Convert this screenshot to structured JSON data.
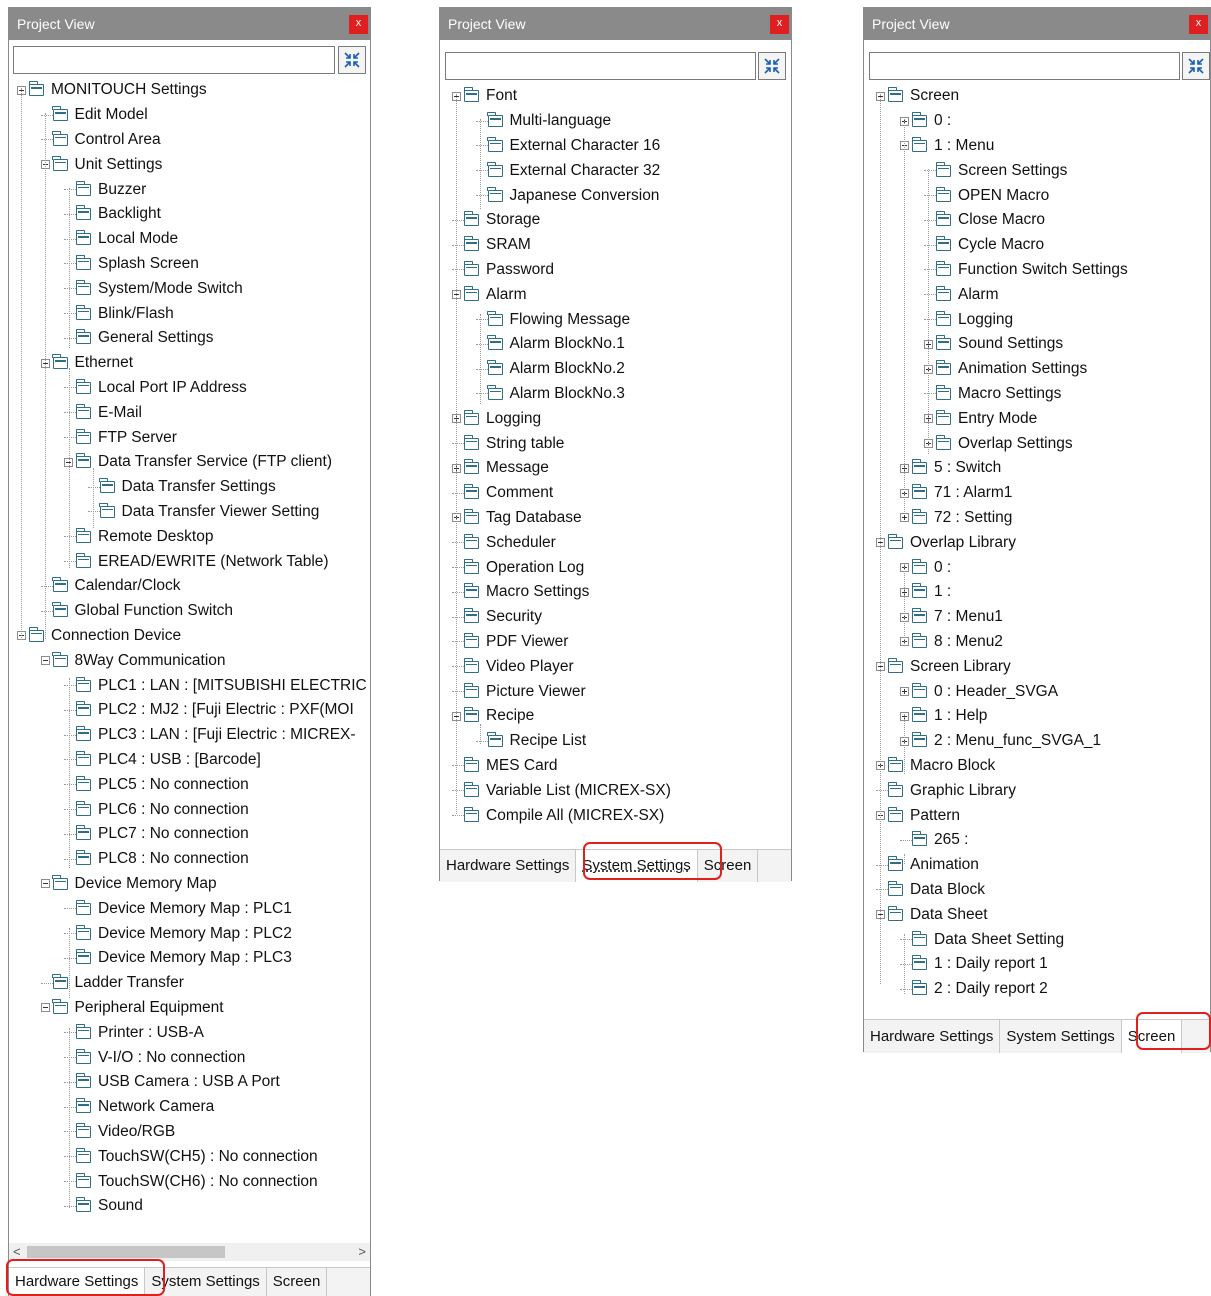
{
  "panels": [
    {
      "id": "hardware",
      "title": "Project View",
      "close_label": "x",
      "search_placeholder": "",
      "tabs": [
        "Hardware Settings",
        "System Settings",
        "Screen"
      ],
      "active_tab": 0,
      "hscroll": {
        "left_arrow": "<",
        "right_arrow": ">"
      },
      "nodes": [
        {
          "d": 0,
          "e": "minus",
          "t": "MONITOUCH Settings"
        },
        {
          "d": 1,
          "e": "",
          "t": "Edit Model"
        },
        {
          "d": 1,
          "e": "",
          "t": "Control Area"
        },
        {
          "d": 1,
          "e": "minus",
          "t": "Unit Settings"
        },
        {
          "d": 2,
          "e": "",
          "t": "Buzzer"
        },
        {
          "d": 2,
          "e": "",
          "t": "Backlight"
        },
        {
          "d": 2,
          "e": "",
          "t": "Local Mode"
        },
        {
          "d": 2,
          "e": "",
          "t": "Splash Screen"
        },
        {
          "d": 2,
          "e": "",
          "t": "System/Mode Switch"
        },
        {
          "d": 2,
          "e": "",
          "t": "Blink/Flash"
        },
        {
          "d": 2,
          "e": "",
          "t": "General Settings"
        },
        {
          "d": 1,
          "e": "minus",
          "t": "Ethernet"
        },
        {
          "d": 2,
          "e": "",
          "t": "Local Port IP Address"
        },
        {
          "d": 2,
          "e": "",
          "t": "E-Mail"
        },
        {
          "d": 2,
          "e": "",
          "t": "FTP Server"
        },
        {
          "d": 2,
          "e": "minus",
          "t": "Data Transfer Service (FTP client)"
        },
        {
          "d": 3,
          "e": "",
          "t": "Data Transfer Settings"
        },
        {
          "d": 3,
          "e": "",
          "t": "Data Transfer Viewer Setting"
        },
        {
          "d": 2,
          "e": "",
          "t": "Remote Desktop"
        },
        {
          "d": 2,
          "e": "",
          "t": "EREAD/EWRITE (Network Table)"
        },
        {
          "d": 1,
          "e": "",
          "t": "Calendar/Clock"
        },
        {
          "d": 1,
          "e": "",
          "t": "Global Function Switch"
        },
        {
          "d": 0,
          "e": "minus",
          "t": "Connection Device"
        },
        {
          "d": 1,
          "e": "minus",
          "t": "8Way Communication"
        },
        {
          "d": 2,
          "e": "",
          "t": "PLC1 : LAN : [MITSUBISHI ELECTRIC"
        },
        {
          "d": 2,
          "e": "",
          "t": "PLC2 : MJ2 : [Fuji Electric : PXF(MOI"
        },
        {
          "d": 2,
          "e": "",
          "t": "PLC3 : LAN : [Fuji Electric : MICREX-"
        },
        {
          "d": 2,
          "e": "",
          "t": "PLC4 : USB : [Barcode]"
        },
        {
          "d": 2,
          "e": "",
          "t": "PLC5 : No connection"
        },
        {
          "d": 2,
          "e": "",
          "t": "PLC6 : No connection"
        },
        {
          "d": 2,
          "e": "",
          "t": "PLC7 : No connection"
        },
        {
          "d": 2,
          "e": "",
          "t": "PLC8 : No connection"
        },
        {
          "d": 1,
          "e": "minus",
          "t": "Device Memory Map"
        },
        {
          "d": 2,
          "e": "",
          "t": "Device Memory Map : PLC1"
        },
        {
          "d": 2,
          "e": "",
          "t": "Device Memory Map : PLC2"
        },
        {
          "d": 2,
          "e": "",
          "t": "Device Memory Map : PLC3"
        },
        {
          "d": 1,
          "e": "",
          "t": "Ladder Transfer"
        },
        {
          "d": 1,
          "e": "minus",
          "t": "Peripheral Equipment"
        },
        {
          "d": 2,
          "e": "",
          "t": "Printer : USB-A"
        },
        {
          "d": 2,
          "e": "",
          "t": "V-I/O : No connection"
        },
        {
          "d": 2,
          "e": "",
          "t": "USB Camera : USB A Port"
        },
        {
          "d": 2,
          "e": "",
          "t": "Network Camera"
        },
        {
          "d": 2,
          "e": "",
          "t": "Video/RGB"
        },
        {
          "d": 2,
          "e": "",
          "t": "TouchSW(CH5) : No connection"
        },
        {
          "d": 2,
          "e": "",
          "t": "TouchSW(CH6) : No connection"
        },
        {
          "d": 2,
          "e": "",
          "t": "Sound"
        }
      ]
    },
    {
      "id": "system",
      "title": "Project View",
      "close_label": "x",
      "search_placeholder": "",
      "tabs": [
        "Hardware Settings",
        "System Settings",
        "Screen"
      ],
      "active_tab": 1,
      "nodes": [
        {
          "d": 0,
          "e": "minus",
          "t": "Font"
        },
        {
          "d": 1,
          "e": "",
          "t": "Multi-language"
        },
        {
          "d": 1,
          "e": "",
          "t": "External Character 16"
        },
        {
          "d": 1,
          "e": "",
          "t": "External Character 32"
        },
        {
          "d": 1,
          "e": "",
          "t": "Japanese Conversion"
        },
        {
          "d": 0,
          "e": "",
          "t": "Storage"
        },
        {
          "d": 0,
          "e": "",
          "t": "SRAM"
        },
        {
          "d": 0,
          "e": "",
          "t": "Password"
        },
        {
          "d": 0,
          "e": "minus",
          "t": "Alarm"
        },
        {
          "d": 1,
          "e": "",
          "t": "Flowing Message"
        },
        {
          "d": 1,
          "e": "",
          "t": "Alarm BlockNo.1"
        },
        {
          "d": 1,
          "e": "",
          "t": "Alarm BlockNo.2"
        },
        {
          "d": 1,
          "e": "",
          "t": "Alarm BlockNo.3"
        },
        {
          "d": 0,
          "e": "plus",
          "t": "Logging"
        },
        {
          "d": 0,
          "e": "",
          "t": "String table"
        },
        {
          "d": 0,
          "e": "plus",
          "t": "Message"
        },
        {
          "d": 0,
          "e": "",
          "t": "Comment"
        },
        {
          "d": 0,
          "e": "plus",
          "t": "Tag Database"
        },
        {
          "d": 0,
          "e": "",
          "t": "Scheduler"
        },
        {
          "d": 0,
          "e": "",
          "t": "Operation Log"
        },
        {
          "d": 0,
          "e": "",
          "t": "Macro Settings"
        },
        {
          "d": 0,
          "e": "",
          "t": "Security"
        },
        {
          "d": 0,
          "e": "",
          "t": "PDF Viewer"
        },
        {
          "d": 0,
          "e": "",
          "t": "Video Player"
        },
        {
          "d": 0,
          "e": "",
          "t": "Picture Viewer"
        },
        {
          "d": 0,
          "e": "minus",
          "t": "Recipe"
        },
        {
          "d": 1,
          "e": "",
          "t": "Recipe List"
        },
        {
          "d": 0,
          "e": "",
          "t": "MES Card"
        },
        {
          "d": 0,
          "e": "",
          "t": "Variable List (MICREX-SX)"
        },
        {
          "d": 0,
          "e": "",
          "t": "Compile All (MICREX-SX)"
        }
      ]
    },
    {
      "id": "screen",
      "title": "Project View",
      "close_label": "x",
      "search_placeholder": "",
      "tabs": [
        "Hardware Settings",
        "System Settings",
        "Screen"
      ],
      "active_tab": 2,
      "nodes": [
        {
          "d": 0,
          "e": "minus",
          "t": "Screen"
        },
        {
          "d": 1,
          "e": "plus",
          "t": "0 :"
        },
        {
          "d": 1,
          "e": "minus",
          "t": "1 : Menu"
        },
        {
          "d": 2,
          "e": "",
          "t": "Screen Settings"
        },
        {
          "d": 2,
          "e": "",
          "t": "OPEN Macro"
        },
        {
          "d": 2,
          "e": "",
          "t": "Close Macro"
        },
        {
          "d": 2,
          "e": "",
          "t": "Cycle Macro"
        },
        {
          "d": 2,
          "e": "",
          "t": "Function Switch Settings"
        },
        {
          "d": 2,
          "e": "",
          "t": "Alarm"
        },
        {
          "d": 2,
          "e": "",
          "t": "Logging"
        },
        {
          "d": 2,
          "e": "plus",
          "t": "Sound Settings"
        },
        {
          "d": 2,
          "e": "plus",
          "t": "Animation Settings"
        },
        {
          "d": 2,
          "e": "",
          "t": "Macro Settings"
        },
        {
          "d": 2,
          "e": "plus",
          "t": "Entry Mode"
        },
        {
          "d": 2,
          "e": "plus",
          "t": "Overlap Settings"
        },
        {
          "d": 1,
          "e": "plus",
          "t": "5 : Switch"
        },
        {
          "d": 1,
          "e": "plus",
          "t": "71 : Alarm1"
        },
        {
          "d": 1,
          "e": "plus",
          "t": "72 : Setting"
        },
        {
          "d": 0,
          "e": "minus",
          "t": "Overlap Library"
        },
        {
          "d": 1,
          "e": "plus",
          "t": "0 :"
        },
        {
          "d": 1,
          "e": "plus",
          "t": "1 :"
        },
        {
          "d": 1,
          "e": "plus",
          "t": "7 : Menu1"
        },
        {
          "d": 1,
          "e": "plus",
          "t": "8 : Menu2"
        },
        {
          "d": 0,
          "e": "minus",
          "t": "Screen Library"
        },
        {
          "d": 1,
          "e": "plus",
          "t": "0 : Header_SVGA"
        },
        {
          "d": 1,
          "e": "plus",
          "t": "1 : Help"
        },
        {
          "d": 1,
          "e": "plus",
          "t": "2 : Menu_func_SVGA_1"
        },
        {
          "d": 0,
          "e": "plus",
          "t": "Macro Block"
        },
        {
          "d": 0,
          "e": "",
          "t": "Graphic Library"
        },
        {
          "d": 0,
          "e": "minus",
          "t": "Pattern"
        },
        {
          "d": 1,
          "e": "",
          "t": "265 :"
        },
        {
          "d": 0,
          "e": "",
          "t": "Animation"
        },
        {
          "d": 0,
          "e": "",
          "t": "Data Block"
        },
        {
          "d": 0,
          "e": "minus",
          "t": "Data Sheet"
        },
        {
          "d": 1,
          "e": "",
          "t": "Data Sheet Setting"
        },
        {
          "d": 1,
          "e": "",
          "t": "1 : Daily report 1"
        },
        {
          "d": 1,
          "e": "",
          "t": "2 : Daily report 2"
        }
      ]
    }
  ],
  "colors": {
    "highlight": "#e02020",
    "titlebar": "#8a8a8a",
    "folder_icon": "#2f6f86"
  }
}
